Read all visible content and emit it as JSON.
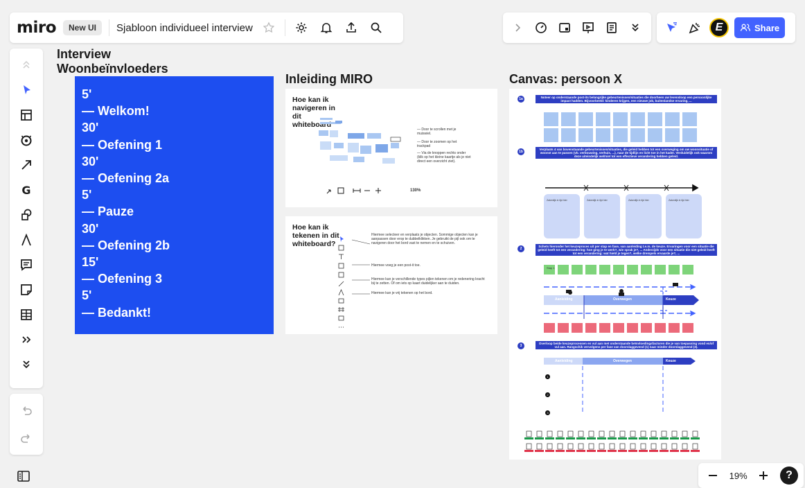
{
  "app": {
    "logo": "miro",
    "new_ui_badge": "New UI",
    "board_title": "Sjabloon individueel interview",
    "share_label": "Share",
    "avatar_initial": "E",
    "zoom": "19%"
  },
  "icons": {
    "top_left": [
      "star-icon",
      "settings-icon",
      "bell-icon",
      "upload-icon",
      "search-icon"
    ],
    "top_mid": [
      "chevron-right-icon",
      "timer-icon",
      "card-icon",
      "presentation-icon",
      "notes-icon",
      "chevron-double-down-icon"
    ],
    "top_right": [
      "cursor-filter-icon",
      "celebrate-icon",
      "avatar",
      "share-button"
    ],
    "tools": [
      "chevron-up-icon",
      "select-icon",
      "template-icon",
      "palette-icon",
      "arrow-icon",
      "google-icon",
      "shapes-icon",
      "pen-icon",
      "comment-icon",
      "sticky-note-icon",
      "table-icon",
      "more-tools-icon",
      "collapse-icon"
    ]
  },
  "canvas": {
    "titles": {
      "interview": "Interview Woonbeïnvloeders",
      "inleiding": "Inleiding MIRO",
      "persoon": "Canvas: persoon X"
    },
    "agenda": [
      "5'",
      "— Welkom!",
      "30'",
      "— Oefening 1",
      "30'",
      " — Oefening 2a",
      "5'",
      "— Pauze",
      "30'",
      " — Oefening 2b",
      "15'",
      " — Oefening 3",
      "5'",
      "— Bedankt!"
    ],
    "nav_card": {
      "title": "Hoe kan ik navigeren in dit whiteboard",
      "lines": [
        "— Door te scrollen met je muiswiel.",
        "— Door te zoomen op het trackpad",
        "— Via de knoppen rechts onder (klik op het kleine kaartje als je niet direct een overzicht ziet)."
      ],
      "zoom": "130%"
    },
    "draw_card": {
      "title": "Hoe kan ik tekenen in dit whiteboard?",
      "lines": [
        "Hiermee selecteer en verplaats je objecten. Sommige objecten kan je aanpassen door erop te dubbelklikken. Je gebruikt de pijl ook om te navigeren door het bord vast te nemen en te schuiven.",
        "Hiermee voeg je een post-it toe.",
        "Hiermee kan je verschillende types pijlen tekenen om je redenering kracht bij te zetten. Of om iets op kaart duidelijker aan te duiden.",
        "Hiermee kan je vrij tekenen op het bord."
      ]
    },
    "persoon": {
      "step1a": "Noteer op onderstaande post-its belangrijke gebeurtenissen/situaties die doorheen uw levensloop een persoonlijke impact hadden. Bijvoorbeeld: kinderen krijgen, een nieuwe job, buitenlandse ervaring, ...",
      "step1b": "Verplaats 4 van bovenstaande gebeurtenissen/situaties, die geleid hebben tot een overweging om uw woonsituatie of woonst aan te passen (vb. verbouwing, verhuis, ...), naar de tijdlijn en licht toe in het kader. Verduidelijk ook waarom deze uiteindelijk wel/niet tot een effectieve verandering hebben geleid.",
      "box_label": "Zakenlijk in tijd hier",
      "step2": "Schets hieronder het keuzeproces uit per stap en fase, van aanleiding t.e.m. de keuze. Ervaringen voor een situatie die geleid heeft tot een verandering: hoe ging je te werk?, wie sprak je?, ... Anderzijds voor een situatie die niet geleid heeft tot een verandering: wat hield je tegen?, welke drempels ervaarde je?, ...",
      "phase_labels": [
        "Aanleiding",
        "Overwegen",
        "Keuze"
      ],
      "stap": "Stap 1",
      "step3": "Overloop beide keuzeprocessen en vul aan met onderstaande beïnvloedingsfactoren die je van toepassing vond en/of vul aan. Rangschik vervolgens per fase van doorslaggevend (1) naar minder doorslaggevend (3).",
      "ranks": [
        "1",
        "2",
        "3"
      ],
      "step_numbers": [
        "1a",
        "1b",
        "2",
        "3"
      ]
    }
  }
}
